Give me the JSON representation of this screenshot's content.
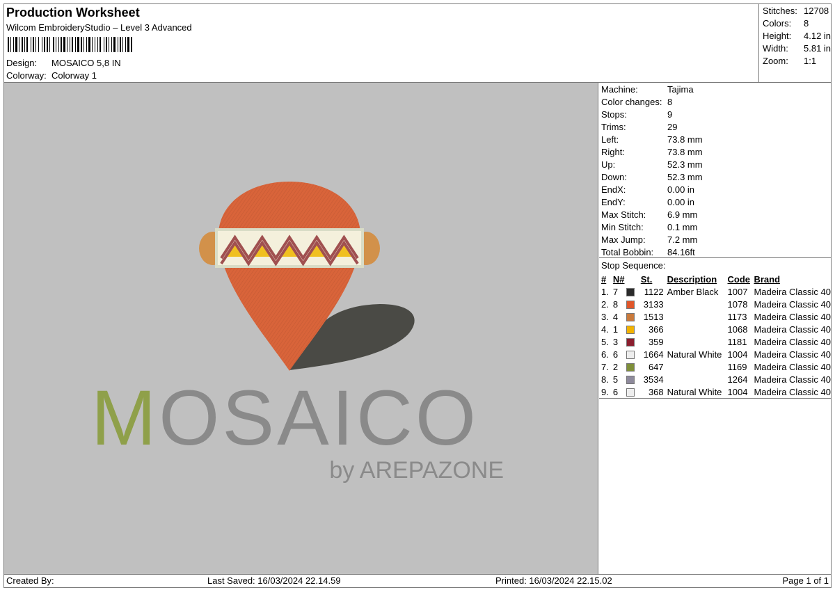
{
  "header": {
    "title": "Production Worksheet",
    "software": "Wilcom EmbroideryStudio – Level 3 Advanced",
    "design_label": "Design:",
    "design_value": "MOSAICO 5,8 IN",
    "colorway_label": "Colorway:",
    "colorway_value": "Colorway 1"
  },
  "stats": [
    {
      "label": "Stitches:",
      "value": "12708"
    },
    {
      "label": "Colors:",
      "value": "8"
    },
    {
      "label": "Height:",
      "value": "4.12 in"
    },
    {
      "label": "Width:",
      "value": "5.81 in"
    },
    {
      "label": "Zoom:",
      "value": "1:1"
    }
  ],
  "machine": [
    {
      "label": "Machine:",
      "value": "Tajima"
    },
    {
      "label": "Color changes:",
      "value": "8"
    },
    {
      "label": "Stops:",
      "value": "9"
    },
    {
      "label": "Trims:",
      "value": "29"
    },
    {
      "label": "Left:",
      "value": "73.8 mm"
    },
    {
      "label": "Right:",
      "value": "73.8 mm"
    },
    {
      "label": "Up:",
      "value": "52.3 mm"
    },
    {
      "label": "Down:",
      "value": "52.3 mm"
    },
    {
      "label": "EndX:",
      "value": "0.00 in"
    },
    {
      "label": "EndY:",
      "value": "0.00 in"
    },
    {
      "label": "Max Stitch:",
      "value": "6.9 mm"
    },
    {
      "label": "Min Stitch:",
      "value": "0.1 mm"
    },
    {
      "label": "Max Jump:",
      "value": "7.2 mm"
    },
    {
      "label": "Total Bobbin:",
      "value": "84.16ft"
    }
  ],
  "stop_sequence": {
    "title": "Stop Sequence:",
    "headers": {
      "idx": "#",
      "n": "N#",
      "st": "St.",
      "desc": "Description",
      "code": "Code",
      "brand": "Brand"
    },
    "rows": [
      {
        "idx": "1.",
        "n": "7",
        "color": "#2b2b2b",
        "st": "1122",
        "desc": "Amber Black",
        "code": "1007",
        "brand": "Madeira Classic 40"
      },
      {
        "idx": "2.",
        "n": "8",
        "color": "#e0562a",
        "st": "3133",
        "desc": "",
        "code": "1078",
        "brand": "Madeira Classic 40"
      },
      {
        "idx": "3.",
        "n": "4",
        "color": "#c97a3c",
        "st": "1513",
        "desc": "",
        "code": "1173",
        "brand": "Madeira Classic 40"
      },
      {
        "idx": "4.",
        "n": "1",
        "color": "#f2b200",
        "st": "366",
        "desc": "",
        "code": "1068",
        "brand": "Madeira Classic 40"
      },
      {
        "idx": "5.",
        "n": "3",
        "color": "#8b1e2e",
        "st": "359",
        "desc": "",
        "code": "1181",
        "brand": "Madeira Classic 40"
      },
      {
        "idx": "6.",
        "n": "6",
        "color": "#eeeeee",
        "st": "1664",
        "desc": "Natural White",
        "code": "1004",
        "brand": "Madeira Classic 40"
      },
      {
        "idx": "7.",
        "n": "2",
        "color": "#7f8f3a",
        "st": "647",
        "desc": "",
        "code": "1169",
        "brand": "Madeira Classic 40"
      },
      {
        "idx": "8.",
        "n": "5",
        "color": "#8e8a9c",
        "st": "3534",
        "desc": "",
        "code": "1264",
        "brand": "Madeira Classic 40"
      },
      {
        "idx": "9.",
        "n": "6",
        "color": "#eeeeee",
        "st": "368",
        "desc": "Natural White",
        "code": "1004",
        "brand": "Madeira Classic 40"
      }
    ]
  },
  "design": {
    "wordmark": "MOSAICO",
    "wordmark_first": "M",
    "wordmark_rest": "OSAICO",
    "byline": "by AREPAZONE",
    "colors": {
      "pin": "#d9643a",
      "shadow": "#4a4a45",
      "ear": "#d2914a",
      "band_bg": "#f4f0dc",
      "band_border": "#d9dcc6",
      "zig_dark": "#a05050",
      "zig_light": "#f0c020",
      "m_green": "#8fa04a",
      "text_gray": "#8a8a8a"
    }
  },
  "footer": {
    "created_by": "Created By:",
    "last_saved": "Last Saved: 16/03/2024 22.14.59",
    "printed": "Printed: 16/03/2024 22.15.02",
    "page": "Page 1 of 1"
  }
}
